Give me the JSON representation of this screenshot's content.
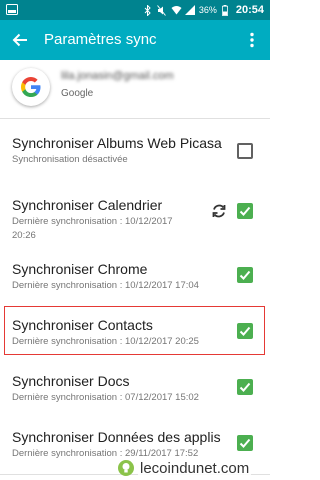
{
  "status_bar": {
    "battery_percent": "36%",
    "time": "20:54"
  },
  "app_bar": {
    "title": "Paramètres sync"
  },
  "account": {
    "email": "lila.jonasin@gmail.com",
    "provider": "Google"
  },
  "sync_items": [
    {
      "title": "Synchroniser Albums Web Picasa",
      "subtitle": "Synchronisation désactivée",
      "checked": false
    },
    {
      "title": "Synchroniser Calendrier",
      "subtitle": "Dernière synchronisation : 10/12/2017",
      "subtitle2": "20:26",
      "checked": true,
      "syncing": true
    },
    {
      "title": "Synchroniser Chrome",
      "subtitle": "Dernière synchronisation : 10/12/2017  17:04",
      "checked": true
    },
    {
      "title": "Synchroniser Contacts",
      "subtitle": "Dernière synchronisation : 10/12/2017  20:25",
      "checked": true,
      "highlighted": true
    },
    {
      "title": "Synchroniser Docs",
      "subtitle": "Dernière synchronisation : 07/12/2017  15:02",
      "checked": true
    },
    {
      "title": "Synchroniser Données des applis",
      "subtitle": "Dernière synchronisation : 29/11/2017  17:52",
      "checked": true
    }
  ],
  "watermark": {
    "text": "lecoindunet.com"
  },
  "colors": {
    "status_bar": "#00838f",
    "app_bar": "#00acc1",
    "checkbox_checked": "#4caf50",
    "highlight_border": "#e53935"
  }
}
